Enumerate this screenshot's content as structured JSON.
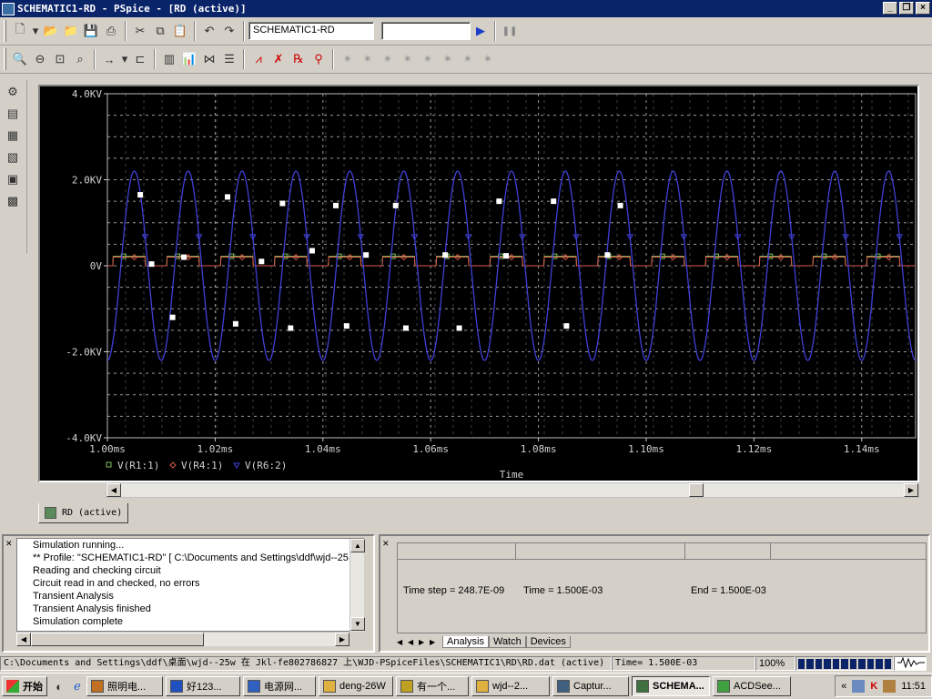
{
  "window": {
    "title": "SCHEMATIC1-RD - PSpice  - [RD (active)]",
    "minimize": "_",
    "restore": "❐",
    "close": "×"
  },
  "toolbar": {
    "profile_value": "SCHEMATIC1-RD",
    "second_field_value": "",
    "run_label": "▶",
    "pause_label": "❚❚"
  },
  "chart_data": {
    "type": "line",
    "xlabel": "Time",
    "xlim": [
      1.0,
      1.15
    ],
    "ylim": [
      -4,
      4
    ],
    "x_ticks": [
      "1.00ms",
      "1.02ms",
      "1.04ms",
      "1.06ms",
      "1.08ms",
      "1.10ms",
      "1.12ms",
      "1.14ms"
    ],
    "y_ticks": [
      "4.0KV",
      "2.0KV",
      "0V",
      "-2.0KV",
      "-4.0KV"
    ],
    "grid": true,
    "legend_position": "bottom-left",
    "series": [
      {
        "name": "V(R1:1)",
        "color": "#7fbf5f",
        "marker": "square",
        "kind": "square-wave",
        "period_ms": 0.01,
        "duty": 0.6,
        "high_kv": 0.22,
        "low_kv": 0.0,
        "phase_ms": 0.001
      },
      {
        "name": "V(R4:1)",
        "color": "#d85a4a",
        "marker": "diamond",
        "kind": "square-wave",
        "period_ms": 0.01,
        "duty": 0.6,
        "high_kv": 0.2,
        "low_kv": 0.0,
        "phase_ms": 0.001
      },
      {
        "name": "V(R6:2)",
        "color": "#4040d8",
        "marker": "triangle",
        "kind": "sine",
        "period_ms": 0.01,
        "amplitude_kv": 2.2,
        "phase_ms": 0.0025
      }
    ],
    "white_markers": [
      {
        "x": 1.0061,
        "y": 1.65
      },
      {
        "x": 1.0082,
        "y": 0.04
      },
      {
        "x": 1.0121,
        "y": -1.2
      },
      {
        "x": 1.0142,
        "y": 0.2
      },
      {
        "x": 1.0223,
        "y": 1.6
      },
      {
        "x": 1.0238,
        "y": -1.35
      },
      {
        "x": 1.0286,
        "y": 0.1
      },
      {
        "x": 1.0325,
        "y": 1.45
      },
      {
        "x": 1.034,
        "y": -1.45
      },
      {
        "x": 1.038,
        "y": 0.35
      },
      {
        "x": 1.0424,
        "y": 1.4
      },
      {
        "x": 1.0444,
        "y": -1.4
      },
      {
        "x": 1.048,
        "y": 0.25
      },
      {
        "x": 1.0535,
        "y": 1.4
      },
      {
        "x": 1.0554,
        "y": -1.45
      },
      {
        "x": 1.0627,
        "y": 0.25
      },
      {
        "x": 1.0653,
        "y": -1.45
      },
      {
        "x": 1.0727,
        "y": 1.5
      },
      {
        "x": 1.074,
        "y": 0.23
      },
      {
        "x": 1.0828,
        "y": 1.5
      },
      {
        "x": 1.0852,
        "y": -1.4
      },
      {
        "x": 1.0928,
        "y": 0.25
      },
      {
        "x": 1.0952,
        "y": 1.4
      }
    ]
  },
  "doc_tab": {
    "label": "RD (active)"
  },
  "output_log": {
    "lines": [
      "Simulation running...",
      "** Profile: \"SCHEMATIC1-RD\"  [ C:\\Documents and Settings\\ddf\\wjd--25",
      "Reading and checking circuit",
      "Circuit read in and checked, no errors",
      "Transient Analysis",
      "Transient Analysis finished",
      "Simulation complete"
    ]
  },
  "sim_status": {
    "time_step": "Time step =  248.7E-09",
    "time": "Time =  1.500E-03",
    "end": "End =  1.500E-03",
    "tabs": [
      "Analysis",
      "Watch",
      "Devices"
    ]
  },
  "statusbar": {
    "path": "C:\\Documents and Settings\\ddf\\桌面\\wjd--25w 在 Jkl-fe802786827 上\\WJD-PSpiceFiles\\SCHEMATIC1\\RD\\RD.dat (active)",
    "time": "Time= 1.500E-03",
    "zoom": "100%"
  },
  "taskbar": {
    "start": "开始",
    "tasks": [
      "照明电...",
      "好123...",
      "电源网...",
      "deng-26W",
      "有一个...",
      "wjd--2...",
      "Captur...",
      "SCHEMA...",
      "ACDSee..."
    ],
    "clock": "11:51",
    "tray_chevron": "«"
  }
}
